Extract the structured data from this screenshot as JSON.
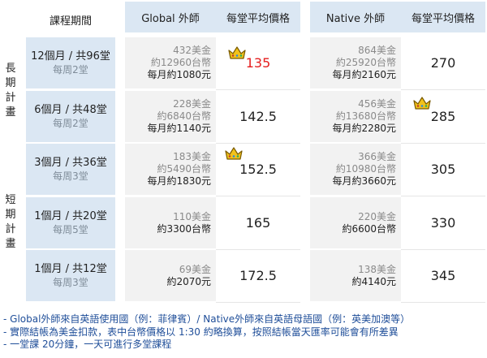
{
  "header": {
    "course_period": "課程期間",
    "global_teacher": "Global 外師",
    "global_avg": "每堂平均價格",
    "native_teacher": "Native 外師",
    "native_avg": "每堂平均價格"
  },
  "side_labels": {
    "long_term": "長期計畫",
    "short_term": "短期計畫"
  },
  "rows": [
    {
      "plan": "12個月 / 共96堂",
      "freq": "每周2堂",
      "g_usd": "432美金",
      "g_twd": "約12960台幣",
      "g_month": "每月約1080元",
      "g_price": "135",
      "n_usd": "864美金",
      "n_twd": "約25920台幣",
      "n_month": "每月約2160元",
      "n_price": "270"
    },
    {
      "plan": "6個月 / 共48堂",
      "freq": "每周2堂",
      "g_usd": "228美金",
      "g_twd": "約6840台幣",
      "g_month": "每月約1140元",
      "g_price": "142.5",
      "n_usd": "456美金",
      "n_twd": "約13680台幣",
      "n_month": "每月約2280元",
      "n_price": "285"
    },
    {
      "plan": "3個月 / 共36堂",
      "freq": "每周3堂",
      "g_usd": "183美金",
      "g_twd": "約5490台幣",
      "g_month": "每月約1830元",
      "g_price": "152.5",
      "n_usd": "366美金",
      "n_twd": "約10980台幣",
      "n_month": "每月約3660元",
      "n_price": "305"
    },
    {
      "plan": "1個月 / 共20堂",
      "freq": "每周5堂",
      "g_usd": "110美金",
      "g_twd": "約3300台幣",
      "g_price": "165",
      "n_usd": "220美金",
      "n_twd": "約6600台幣",
      "n_price": "330"
    },
    {
      "plan": "1個月 / 共12堂",
      "freq": "每周3堂",
      "g_usd": "69美金",
      "g_twd": "約2070元",
      "g_price": "172.5",
      "n_usd": "138美金",
      "n_twd": "約4140元",
      "n_price": "345"
    }
  ],
  "notes": [
    "- Global外師來自英語使用國（例：菲律賓）/ Native外師來自英語母語國（例：英美加澳等）",
    "- 實際結帳為美金扣款，表中台幣價格以 1:30 約略換算，按照結帳當天匯率可能會有所差異",
    "- 一堂課 20分鐘，一天可進行多堂課程"
  ],
  "colors": {
    "header_bg": "#dbe7f3",
    "amount_bg": "#f2f2f2",
    "highlight_price": "#e51c1c",
    "note_text": "#1f4e99",
    "crown": "#f2c21b"
  }
}
